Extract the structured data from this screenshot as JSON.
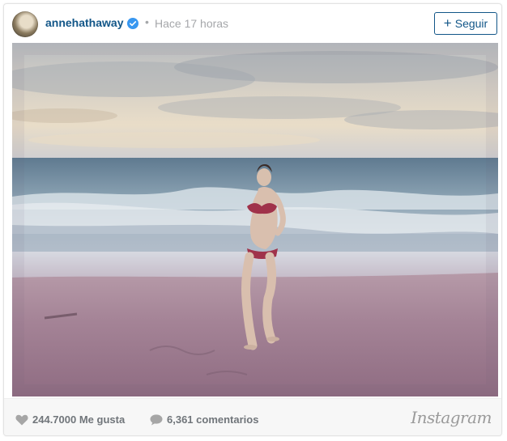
{
  "post": {
    "username": "annehathaway",
    "verified": true,
    "separator": "•",
    "timestamp": "Hace 17 horas",
    "follow_label": "Seguir",
    "follow_plus": "+"
  },
  "photo": {
    "description_icon": "beach-photo"
  },
  "footer": {
    "likes": "244.7000 Me gusta",
    "comments": "6,361 comentarios",
    "brand": "Instagram"
  },
  "colors": {
    "link_blue": "#125688",
    "muted": "#a5a7aa",
    "verified_blue": "#3897f0"
  },
  "icons": [
    "avatar",
    "verified-badge-icon",
    "heart-icon",
    "comment-icon"
  ]
}
